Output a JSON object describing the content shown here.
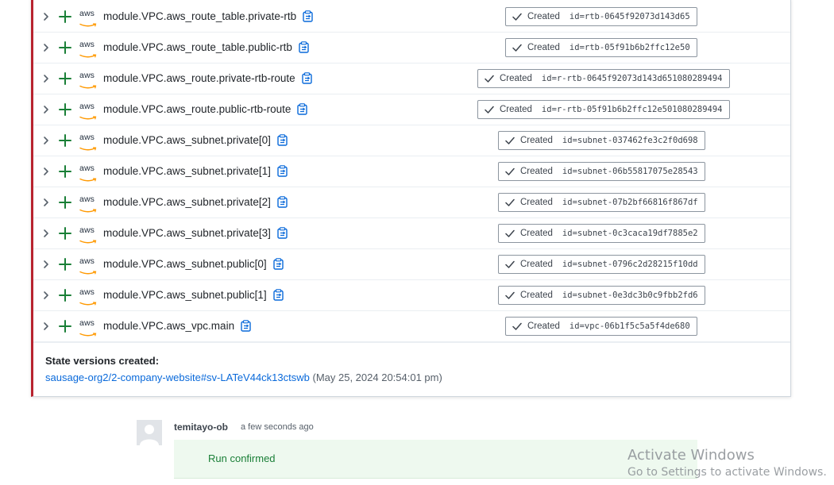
{
  "resources": [
    {
      "name": "module.VPC.aws_route_table.private-rtb",
      "status": "Created",
      "id": "id=rtb-0645f92073d143d65"
    },
    {
      "name": "module.VPC.aws_route_table.public-rtb",
      "status": "Created",
      "id": "id=rtb-05f91b6b2ffc12e50"
    },
    {
      "name": "module.VPC.aws_route.private-rtb-route",
      "status": "Created",
      "id": "id=r-rtb-0645f92073d143d651080289494"
    },
    {
      "name": "module.VPC.aws_route.public-rtb-route",
      "status": "Created",
      "id": "id=r-rtb-05f91b6b2ffc12e501080289494"
    },
    {
      "name": "module.VPC.aws_subnet.private[0]",
      "status": "Created",
      "id": "id=subnet-037462fe3c2f0d698"
    },
    {
      "name": "module.VPC.aws_subnet.private[1]",
      "status": "Created",
      "id": "id=subnet-06b55817075e28543"
    },
    {
      "name": "module.VPC.aws_subnet.private[2]",
      "status": "Created",
      "id": "id=subnet-07b2bf66816f867df"
    },
    {
      "name": "module.VPC.aws_subnet.private[3]",
      "status": "Created",
      "id": "id=subnet-0c3caca19df7885e2"
    },
    {
      "name": "module.VPC.aws_subnet.public[0]",
      "status": "Created",
      "id": "id=subnet-0796c2d28215f10dd"
    },
    {
      "name": "module.VPC.aws_subnet.public[1]",
      "status": "Created",
      "id": "id=subnet-0e3dc3b0c9fbb2fd6"
    },
    {
      "name": "module.VPC.aws_vpc.main",
      "status": "Created",
      "id": "id=vpc-06b1f5c5a5f4de680"
    }
  ],
  "provider_label": "aws",
  "state_versions": {
    "title": "State versions created:",
    "link": "sausage-org2/2-company-website#sv-LATeV44ck13ctswb",
    "date": "(May 25, 2024 20:54:01 pm)"
  },
  "comment": {
    "user": "temitayo-ob",
    "time": "a few seconds ago",
    "message": "Run confirmed"
  },
  "watermark": {
    "title": "Activate Windows",
    "subtitle": "Go to Settings to activate Windows."
  },
  "colors": {
    "accent_border": "#b8232f",
    "plus_green": "#1a7f37",
    "link_blue": "#0969da",
    "confirm_bg": "#eef9ef"
  },
  "icons": {
    "expand": "chevron-right-icon",
    "added": "plus-icon",
    "provider": "aws-logo-icon",
    "copy": "clipboard-icon",
    "status": "checkmark-icon"
  }
}
